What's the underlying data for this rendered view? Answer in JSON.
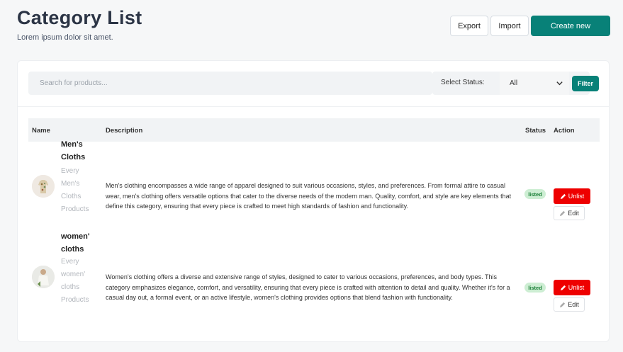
{
  "header": {
    "title": "Category List",
    "subtitle": "Lorem ipsum dolor sit amet.",
    "export_label": "Export",
    "import_label": "Import",
    "create_label": "Create new"
  },
  "filters": {
    "search_placeholder": "Search for products...",
    "status_label": "Select Status:",
    "status_value": "All",
    "filter_label": "Filter"
  },
  "table": {
    "columns": [
      "Name",
      "Description",
      "Status",
      "Action"
    ],
    "rows": [
      {
        "name_line1": "Men's",
        "name_line2": "Cloths",
        "sub": [
          "Every",
          "Men's",
          "Cloths",
          "Products"
        ],
        "description": "Men's clothing encompasses a wide range of apparel designed to suit various occasions, styles, and preferences. From formal attire to casual wear, men's clothing offers versatile options that cater to the diverse needs of the modern man. Quality, comfort, and style are key elements that define this category, ensuring that every piece is crafted to meet high standards of fashion and functionality.",
        "status": "listed",
        "unlist_label": "Unlist",
        "edit_label": "Edit"
      },
      {
        "name_line1": "women'",
        "name_line2": "cloths",
        "sub": [
          "Every",
          "women'",
          "cloths",
          "Products"
        ],
        "description": "Women's clothing offers a diverse and extensive range of styles, designed to cater to various occasions, preferences, and body types. This category emphasizes elegance, comfort, and versatility, ensuring that every piece is crafted with attention to detail and quality. Whether it's for a casual day out, a formal event, or an active lifestyle, women's clothing provides options that blend fashion with functionality.",
        "status": "listed",
        "unlist_label": "Unlist",
        "edit_label": "Edit"
      }
    ]
  },
  "colors": {
    "accent": "#088178",
    "danger": "#ee0000",
    "badge_bg": "#cdeed3",
    "badge_text": "#1a7f37"
  },
  "icons": [
    "chevron-down-icon",
    "pencil-icon"
  ]
}
